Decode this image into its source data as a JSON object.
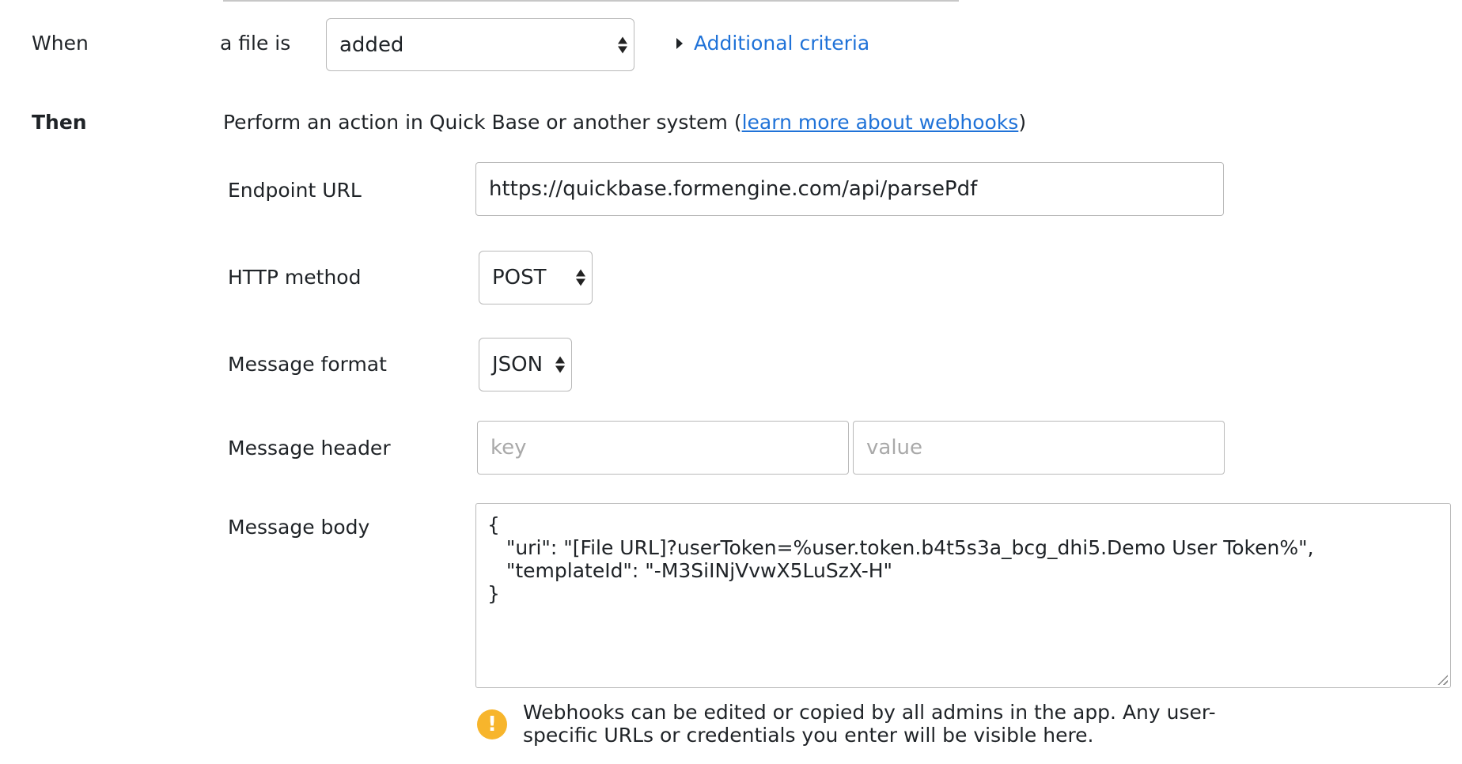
{
  "trigger": {
    "when_label": "When",
    "condition_prefix": "a file is",
    "event_select": {
      "value": "added"
    },
    "additional_criteria_link": "Additional criteria"
  },
  "action": {
    "then_label": "Then",
    "description_prefix": "Perform an action in Quick Base or another system (",
    "learn_more_link": "learn more about webhooks",
    "description_suffix": ")"
  },
  "fields": {
    "endpoint_url": {
      "label": "Endpoint URL",
      "value": "https://quickbase.formengine.com/api/parsePdf"
    },
    "http_method": {
      "label": "HTTP method",
      "value": "POST"
    },
    "message_format": {
      "label": "Message format",
      "value": "JSON"
    },
    "message_header": {
      "label": "Message header",
      "key_placeholder": "key",
      "value_placeholder": "value"
    },
    "message_body": {
      "label": "Message body",
      "lines": [
        "{",
        "   \"uri\": \"[File URL]?userToken=%user.token.b4t5s3a_bcg_dhi5.Demo User Token%\",",
        "   \"templateId\": \"-M3SiINjVvwX5LuSzX-H\"",
        "}"
      ]
    }
  },
  "notice": {
    "icon": "warning-icon",
    "line1": "Webhooks can be edited or copied by all admins in the app. Any user-",
    "line2": "specific URLs or credentials you enter will be visible here."
  },
  "colors": {
    "link": "#1f72d8",
    "warning": "#f7b52c",
    "border": "#b9b9b9",
    "text": "#1f2327"
  }
}
